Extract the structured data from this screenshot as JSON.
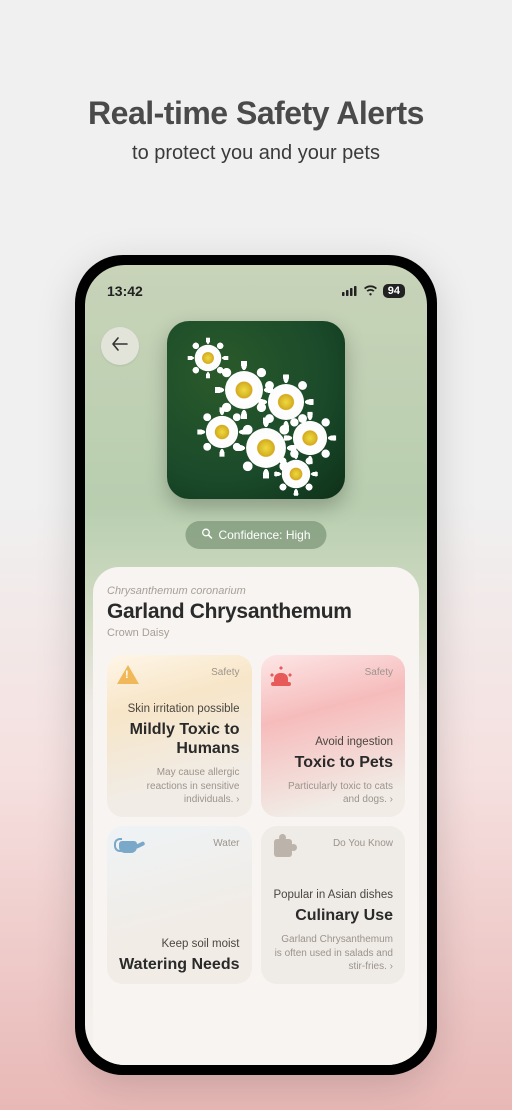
{
  "page": {
    "title": "Real-time Safety Alerts",
    "subtitle": "to protect you and your pets"
  },
  "status": {
    "time": "13:42",
    "battery": "94"
  },
  "confidence": {
    "label": "Confidence: High"
  },
  "plant": {
    "scientific": "Chrysanthemum coronarium",
    "common": "Garland Chrysanthemum",
    "alt": "Crown Daisy"
  },
  "tiles": [
    {
      "category": "Safety",
      "sub": "Skin irritation possible",
      "title": "Mildly Toxic to Humans",
      "desc": "May cause allergic reactions in sensitive individuals."
    },
    {
      "category": "Safety",
      "sub": "Avoid ingestion",
      "title": "Toxic to Pets",
      "desc": "Particularly toxic to cats and dogs."
    },
    {
      "category": "Water",
      "sub": "Keep soil moist",
      "title": "Watering Needs",
      "desc": ""
    },
    {
      "category": "Do You Know",
      "sub": "Popular in Asian dishes",
      "title": "Culinary Use",
      "desc": "Garland Chrysanthemum is often used in salads and stir-fries."
    }
  ]
}
